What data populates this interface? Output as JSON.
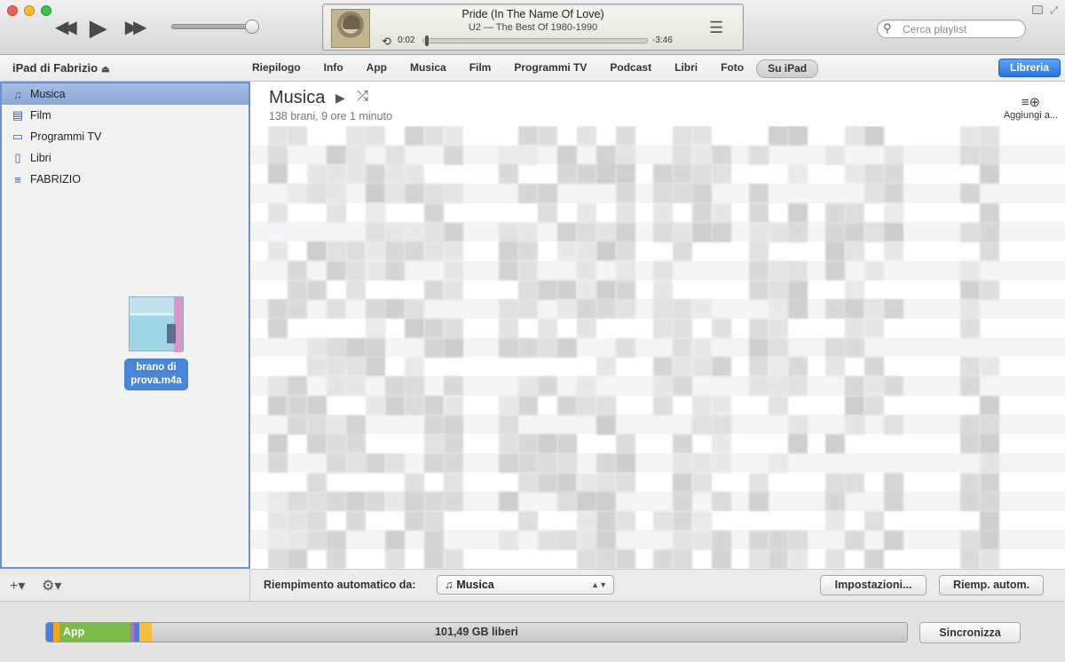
{
  "player": {
    "controls": {
      "prev_icon": "◀◀",
      "play_icon": "▶",
      "next_icon": "▶▶"
    },
    "song_title": "Pride (In The Name Of Love)",
    "song_subtitle": "U2 — The Best Of 1980-1990",
    "time_elapsed": "0:02",
    "time_remaining": "-3:46",
    "progress_fraction": 0.009,
    "volume_fraction": 0.95,
    "repeat_icon": "⟲",
    "upnext_icon": "☰"
  },
  "search": {
    "placeholder": "Cerca playlist",
    "icon": "⚲"
  },
  "device": {
    "name": "iPad di Fabrizio",
    "eject_icon": "⏏"
  },
  "tabs": [
    {
      "label": "Riepilogo"
    },
    {
      "label": "Info"
    },
    {
      "label": "App"
    },
    {
      "label": "Musica"
    },
    {
      "label": "Film"
    },
    {
      "label": "Programmi TV"
    },
    {
      "label": "Podcast"
    },
    {
      "label": "Libri"
    },
    {
      "label": "Foto"
    },
    {
      "label": "Su iPad",
      "active": true
    }
  ],
  "library_button": "Libreria",
  "sidebar": {
    "items": [
      {
        "label": "Musica",
        "icon": "♫",
        "selected": true
      },
      {
        "label": "Film",
        "icon": "▤"
      },
      {
        "label": "Programmi TV",
        "icon": "▭"
      },
      {
        "label": "Libri",
        "icon": "▯"
      },
      {
        "label": "FABRIZIO",
        "icon": "≡"
      }
    ],
    "dragged_file": {
      "label_line1": "brano di",
      "label_line2": "prova.m4a"
    },
    "footer": {
      "add_icon": "+▾",
      "gear_icon": "⚙▾"
    }
  },
  "main": {
    "title": "Musica",
    "play_icon": "▶",
    "shuffle_icon": "⤮",
    "subtitle": "138 brani, 9 ore 1 minuto",
    "add_to": {
      "icon": "≡⊕",
      "label": "Aggiungi a..."
    }
  },
  "bottom": {
    "autofill_label": "Riempimento automatico da:",
    "autofill_value": "Musica",
    "autofill_icon": "♫",
    "autofill_chevron": "▲▼",
    "settings_button": "Impostazioni...",
    "autofill_button": "Riemp. autom."
  },
  "storage": {
    "app_label": "App",
    "free_label": "101,49 GB liberi",
    "sync_button": "Sincronizza"
  },
  "colors": {
    "accent": "#2a74dc",
    "selection": "#8aa6d4",
    "app_segment": "#7dbb48"
  }
}
